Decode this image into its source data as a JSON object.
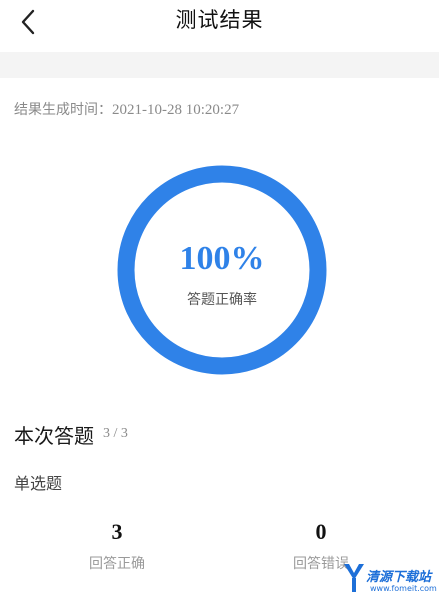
{
  "header": {
    "title": "测试结果",
    "back_icon": "chevron-left-icon"
  },
  "result": {
    "time_label": "结果生成时间：",
    "time_value": "2021-10-28 10:20:27",
    "accuracy_value": "100%",
    "accuracy_fraction": 1.0,
    "accuracy_label": "答题正确率",
    "ring_color": "#2f82e8"
  },
  "summary": {
    "title": "本次答题",
    "count": "3 / 3",
    "question_type": "单选题",
    "correct_count": "3",
    "correct_label": "回答正确",
    "wrong_count": "0",
    "wrong_label": "回答错误"
  },
  "watermark": {
    "text": "清源下载站",
    "url": "www.fomeit.com"
  }
}
